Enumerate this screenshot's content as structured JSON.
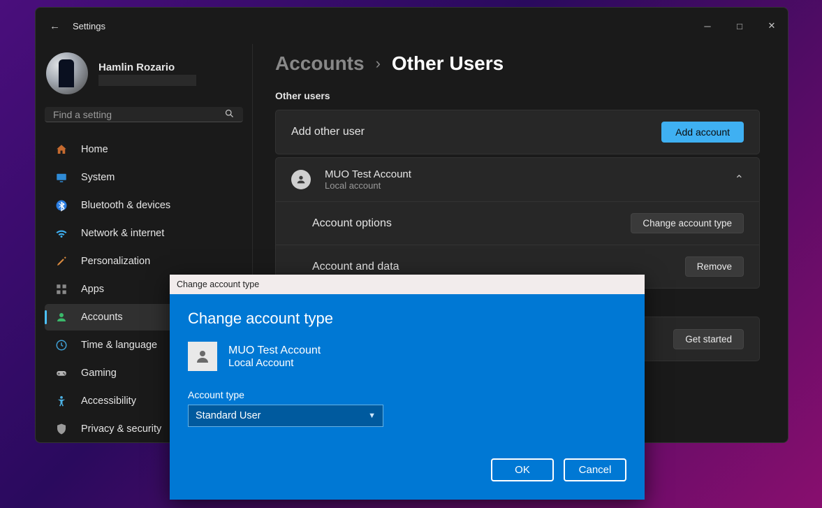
{
  "window": {
    "title": "Settings"
  },
  "user": {
    "name": "Hamlin Rozario"
  },
  "search": {
    "placeholder": "Find a setting"
  },
  "nav": {
    "items": [
      {
        "id": "home",
        "label": "Home"
      },
      {
        "id": "system",
        "label": "System"
      },
      {
        "id": "bluetooth",
        "label": "Bluetooth & devices"
      },
      {
        "id": "network",
        "label": "Network & internet"
      },
      {
        "id": "personalization",
        "label": "Personalization"
      },
      {
        "id": "apps",
        "label": "Apps"
      },
      {
        "id": "accounts",
        "label": "Accounts",
        "selected": true
      },
      {
        "id": "time",
        "label": "Time & language"
      },
      {
        "id": "gaming",
        "label": "Gaming"
      },
      {
        "id": "accessibility",
        "label": "Accessibility"
      },
      {
        "id": "privacy",
        "label": "Privacy & security"
      }
    ]
  },
  "breadcrumb": {
    "parent": "Accounts",
    "current": "Other Users"
  },
  "content": {
    "section_title": "Other users",
    "add_other_user_label": "Add other user",
    "add_account_btn": "Add account",
    "account": {
      "name": "MUO Test Account",
      "subtitle": "Local account"
    },
    "account_options_label": "Account options",
    "change_type_btn": "Change account type",
    "account_data_label": "Account and data",
    "remove_btn": "Remove",
    "get_started_btn": "Get started"
  },
  "dialog": {
    "title": "Change account type",
    "heading": "Change account type",
    "user_name": "MUO Test Account",
    "user_sub": "Local Account",
    "type_label": "Account type",
    "selected_type": "Standard User",
    "ok": "OK",
    "cancel": "Cancel"
  }
}
